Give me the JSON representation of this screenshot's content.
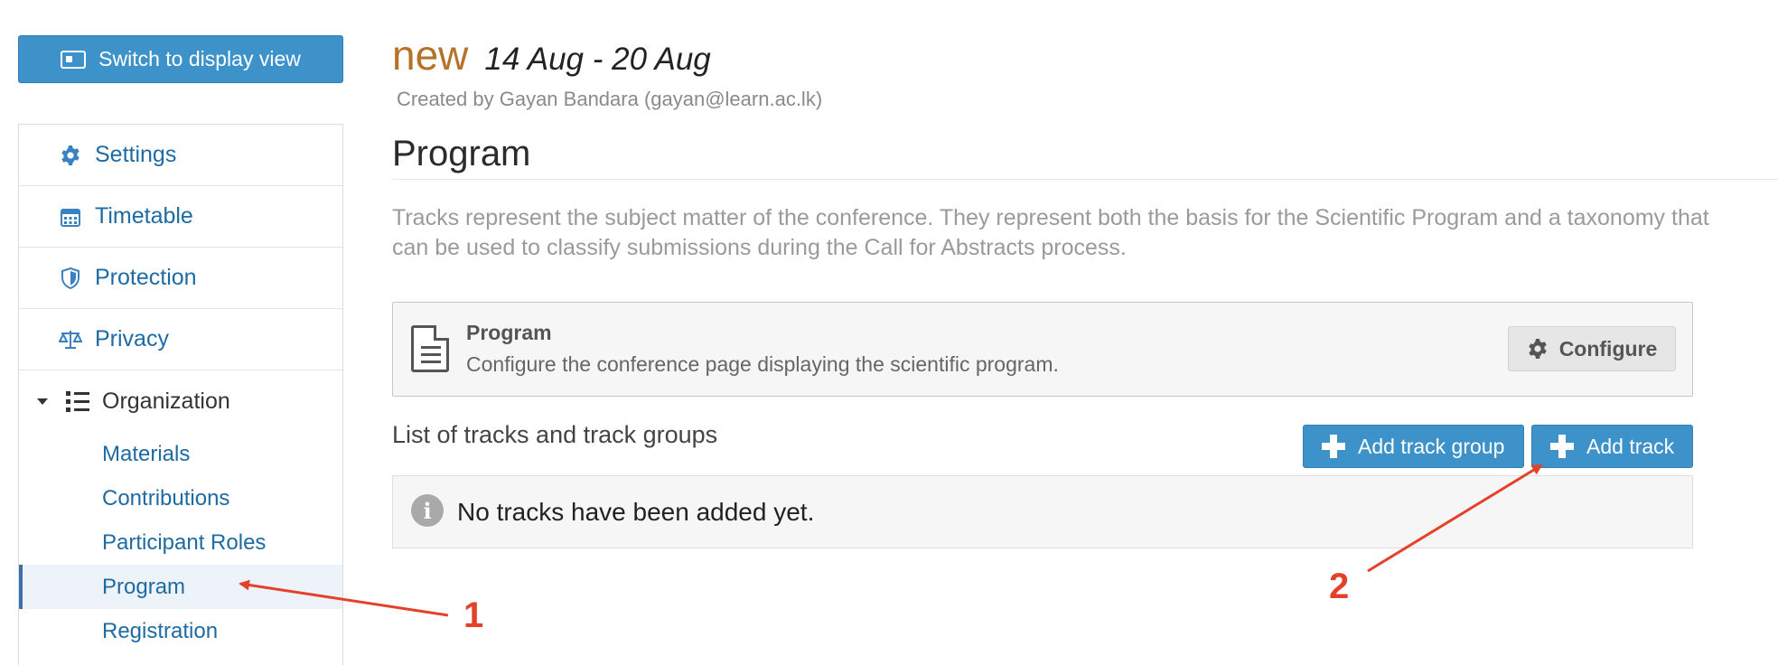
{
  "display_button": {
    "label": "Switch to display view"
  },
  "sidebar": {
    "items": [
      {
        "label": "Settings",
        "icon": "gear-icon"
      },
      {
        "label": "Timetable",
        "icon": "calendar-icon"
      },
      {
        "label": "Protection",
        "icon": "shield-icon"
      },
      {
        "label": "Privacy",
        "icon": "balance-scale-icon"
      }
    ],
    "organization": {
      "label": "Organization",
      "icon": "list-icon",
      "expanded": true,
      "children": [
        {
          "label": "Materials",
          "active": false
        },
        {
          "label": "Contributions",
          "active": false
        },
        {
          "label": "Participant Roles",
          "active": false
        },
        {
          "label": "Program",
          "active": true
        },
        {
          "label": "Registration",
          "active": false
        }
      ]
    }
  },
  "header": {
    "event_name": "new",
    "dates": "14 Aug - 20 Aug",
    "created_by": "Created by Gayan Bandara (gayan@learn.ac.lk)"
  },
  "page": {
    "title": "Program",
    "description": "Tracks represent the subject matter of the conference. They represent both the basis for the Scientific Program and a taxonomy that can be used to classify submissions during the Call for Abstracts process."
  },
  "program_box": {
    "title": "Program",
    "subtitle": "Configure the conference page displaying the scientific program.",
    "configure_label": "Configure"
  },
  "tracks": {
    "heading": "List of tracks and track groups",
    "add_group_label": "Add track group",
    "add_track_label": "Add track",
    "empty_message": "No tracks have been added yet."
  },
  "annotations": {
    "marker_1": "1",
    "marker_2": "2"
  },
  "colors": {
    "primary_button": "#3d92c9",
    "event_name": "#b6722a",
    "link": "#1e6aa3",
    "annotation": "#e4412b"
  }
}
